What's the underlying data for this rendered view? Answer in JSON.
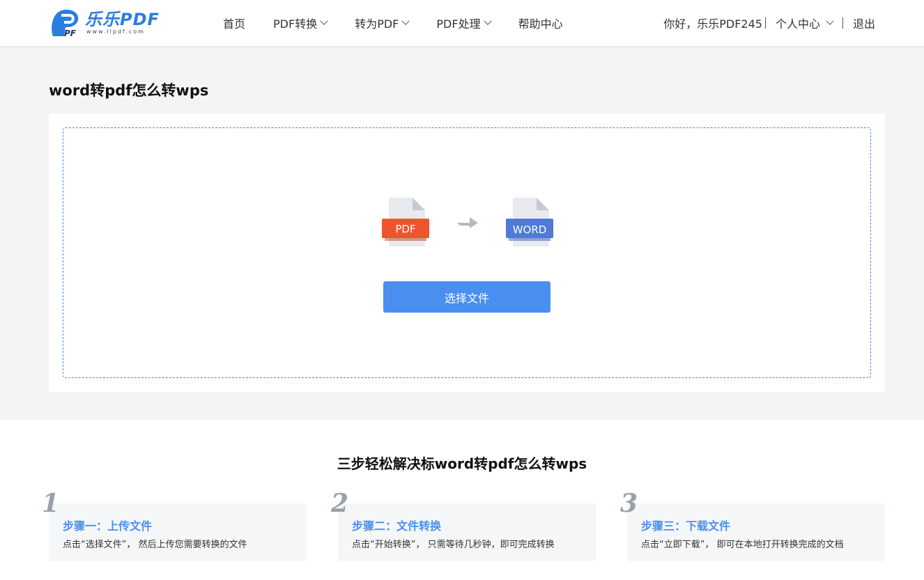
{
  "header": {
    "logo_title": "乐乐PDF",
    "logo_sub": "www.llpdf.com",
    "nav": [
      {
        "label": "首页",
        "has_dropdown": false
      },
      {
        "label": "PDF转换",
        "has_dropdown": true
      },
      {
        "label": "转为PDF",
        "has_dropdown": true
      },
      {
        "label": "PDF处理",
        "has_dropdown": true
      },
      {
        "label": "帮助中心",
        "has_dropdown": false
      }
    ],
    "greeting": "你好，乐乐PDF245",
    "user_center": "个人中心",
    "logout": "退出"
  },
  "main": {
    "page_title": "word转pdf怎么转wps",
    "source_label": "PDF",
    "target_label": "WORD",
    "select_button": "选择文件"
  },
  "steps": {
    "title": "三步轻松解决标word转pdf怎么转wps",
    "items": [
      {
        "num": "1",
        "title": "步骤一：上传文件",
        "desc": "点击“选择文件”， 然后上传您需要转换的文件"
      },
      {
        "num": "2",
        "title": "步骤二：文件转换",
        "desc": "点击“开始转换”， 只需等待几秒钟，即可完成转换"
      },
      {
        "num": "3",
        "title": "步骤三：下载文件",
        "desc": "点击“立即下载”， 即可在本地打开转换完成的文档"
      }
    ]
  },
  "colors": {
    "accent": "#4a8ff0",
    "pdf_red": "#f0542d",
    "word_blue": "#4f7ad6"
  }
}
